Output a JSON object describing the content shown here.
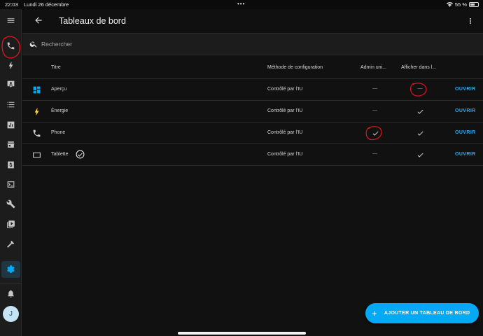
{
  "statusbar": {
    "time": "22:03",
    "date": "Lundi 26 décembre",
    "dots": "•••",
    "battery": "55 %",
    "battery_level": 0.55
  },
  "header": {
    "title": "Tableaux de bord"
  },
  "search": {
    "placeholder": "Rechercher"
  },
  "table": {
    "columns": {
      "title": "Titre",
      "method": "Méthode de configuration",
      "admin": "Admin uni...",
      "show": "Afficher dans l..."
    },
    "rows": [
      {
        "icon": "grid-icon",
        "title": "Aperçu",
        "method": "Contrôlé par l'IU",
        "admin": "—",
        "show": "—",
        "action": "OUVRIR"
      },
      {
        "icon": "lightning-icon",
        "title": "Énergie",
        "method": "Contrôlé par l'IU",
        "admin": "—",
        "show": "✓",
        "action": "OUVRIR"
      },
      {
        "icon": "phone-icon",
        "title": "Phone",
        "method": "Contrôlé par l'IU",
        "admin": "✓",
        "show": "✓",
        "action": "OUVRIR"
      },
      {
        "icon": "tablet-icon",
        "title": "Tablette",
        "method": "Contrôlé par l'IU",
        "admin": "—",
        "show": "✓",
        "action": "OUVRIR",
        "default": true
      }
    ]
  },
  "fab": {
    "label": "AJOUTER UN TABLEAU DE BORD"
  },
  "user": {
    "initial": "J"
  },
  "colors": {
    "accent": "#03a9f4",
    "energy": "#fdd835",
    "overview": "#03a9f4",
    "annotation": "#e0161b"
  }
}
